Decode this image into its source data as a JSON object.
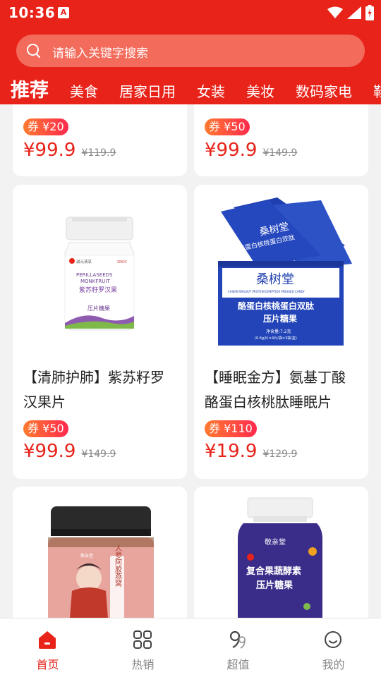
{
  "status_bar": {
    "time": "10:36",
    "app_icon_letter": "A"
  },
  "search": {
    "placeholder": "请输入关键字搜索"
  },
  "categories": [
    "推荐",
    "美食",
    "居家日用",
    "女装",
    "美妆",
    "数码家电",
    "鞋"
  ],
  "products": [
    {
      "coupon": "券 ¥20",
      "price": "¥99.9",
      "original": "¥119.9"
    },
    {
      "coupon": "券 ¥50",
      "price": "¥99.9",
      "original": "¥149.9"
    },
    {
      "title": "【清肺护肺】紫苏籽罗汉果片",
      "coupon": "券 ¥50",
      "price": "¥99.9",
      "original": "¥149.9",
      "label": {
        "en1": "PERILLASEEDS",
        "en2": "MONKFRUIT",
        "cn": "紫苏籽罗汉果",
        "sub": "压片糖果",
        "brand": "滋元清享"
      }
    },
    {
      "title": "【睡眠金方】氨基丁酸酪蛋白核桃肽睡眠片",
      "coupon": "券 ¥110",
      "price": "¥19.9",
      "original": "¥129.9",
      "label": {
        "brand": "桑树堂",
        "line1": "酪蛋白核桃蛋白双肽",
        "line2": "压片糖果",
        "net": "净含量:7.2克",
        "spec": "(0.6g/片×4片/袋×3袋/盒)"
      }
    },
    {
      "label": {
        "brand": "敬亲堂",
        "cn": "人参阿胶燕窝"
      }
    },
    {
      "label": {
        "brand": "敬亲堂",
        "line1": "复合果蔬酵素",
        "line2": "压片糖果"
      }
    }
  ],
  "tabbar": [
    {
      "label": "首页",
      "icon": "home-icon",
      "active": true
    },
    {
      "label": "热销",
      "icon": "grid-icon",
      "active": false
    },
    {
      "label": "超值",
      "icon": "nine-nine-icon",
      "active": false
    },
    {
      "label": "我的",
      "icon": "smile-icon",
      "active": false
    }
  ],
  "colors": {
    "brand_red": "#e8231a",
    "price_red": "#e8231a"
  }
}
